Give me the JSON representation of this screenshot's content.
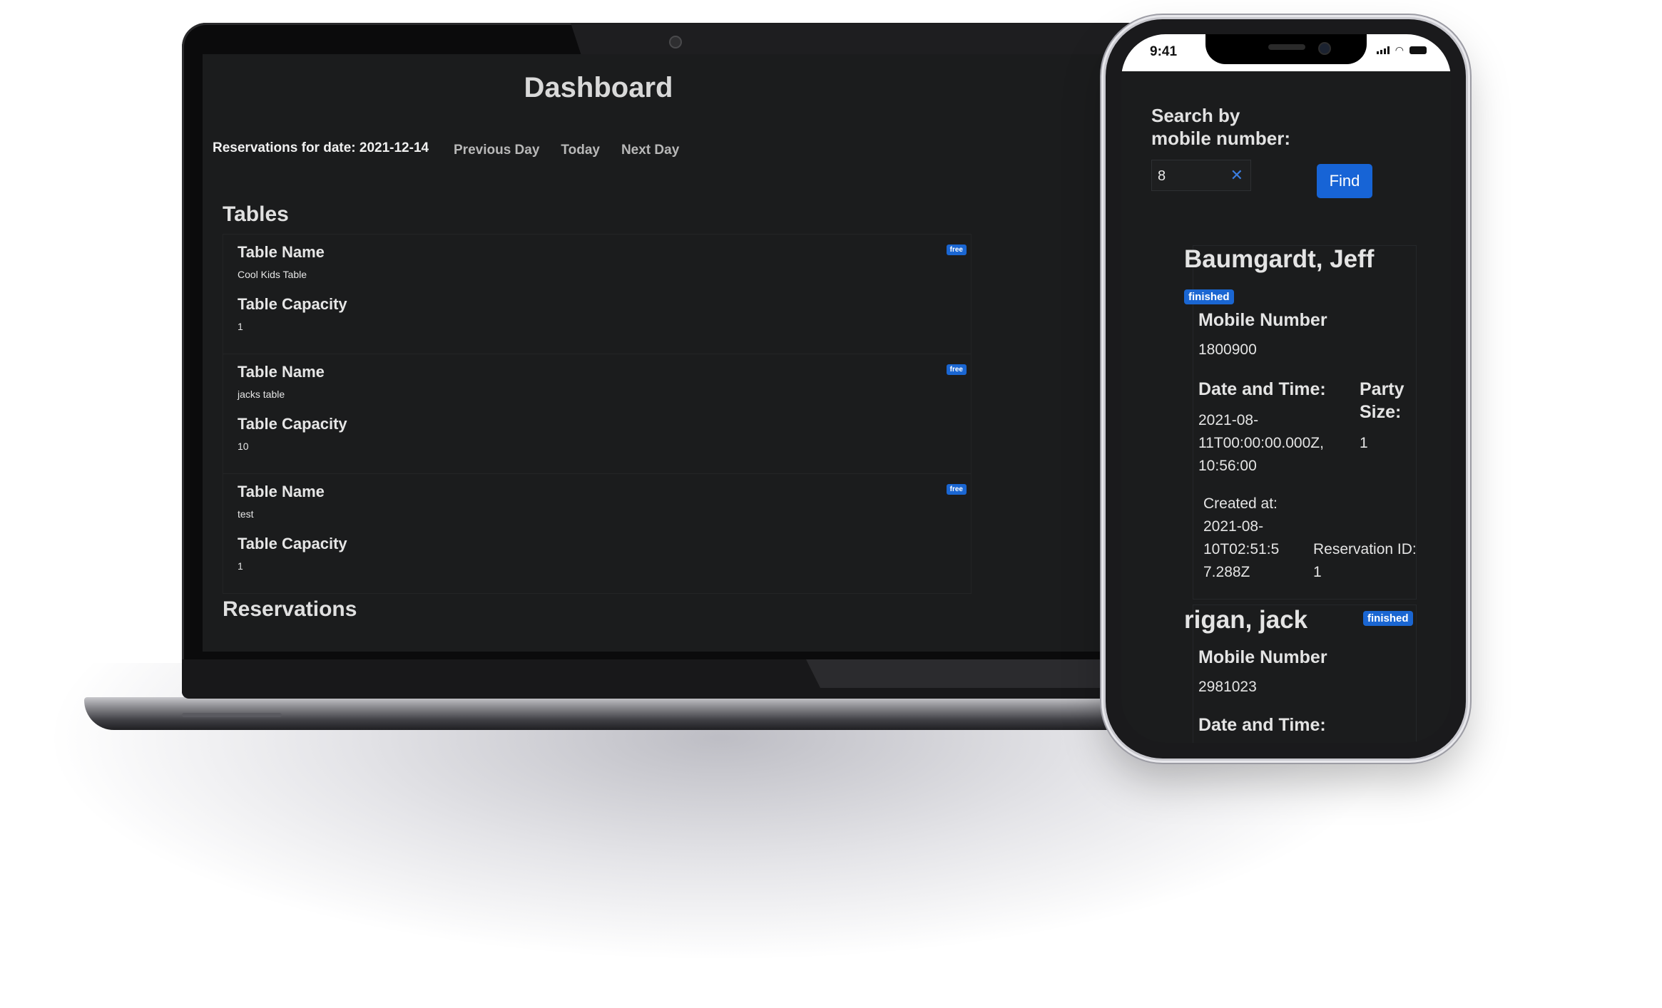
{
  "laptop": {
    "title": "Dashboard",
    "reservations_date_label": "Reservations for date: 2021-12-14",
    "nav": {
      "previous": "Previous Day",
      "today": "Today",
      "next": "Next Day"
    },
    "tables_heading": "Tables",
    "reservations_heading": "Reservations",
    "tables": [
      {
        "name_label": "Table Name",
        "name": "Cool Kids Table",
        "capacity_label": "Table Capacity",
        "capacity": "1",
        "status": "free"
      },
      {
        "name_label": "Table Name",
        "name": "jacks table",
        "capacity_label": "Table Capacity",
        "capacity": "10",
        "status": "free"
      },
      {
        "name_label": "Table Name",
        "name": "test",
        "capacity_label": "Table Capacity",
        "capacity": "1",
        "status": "free"
      }
    ]
  },
  "phone": {
    "status_time": "9:41",
    "search_label_line1": "Search by",
    "search_label_line2": "mobile number:",
    "search_value": "8",
    "find_label": "Find",
    "reservations": [
      {
        "name": "Baumgardt, Jeff",
        "status": "finished",
        "mobile_label": "Mobile Number",
        "mobile": "1800900",
        "datetime_label": "Date and Time:",
        "datetime_line1": "2021-08-",
        "datetime_line2": "11T00:00:00.000Z,",
        "datetime_line3": "10:56:00",
        "party_label_line1": "Party",
        "party_label_line2": "Size:",
        "party_size": "1",
        "created_label": "Created at:",
        "created_line1": "2021-08-",
        "created_line2": "10T02:51:5",
        "created_line3": "7.288Z",
        "reservation_id_label": "Reservation ID:",
        "reservation_id": "1"
      },
      {
        "name": "rigan, jack",
        "status": "finished",
        "mobile_label": "Mobile Number",
        "mobile": "2981023",
        "datetime_label": "Date and Time:"
      }
    ]
  },
  "colors": {
    "screen_bg": "#1b1c1d",
    "badge_blue": "#1a66d2",
    "button_blue": "#1764d6"
  }
}
